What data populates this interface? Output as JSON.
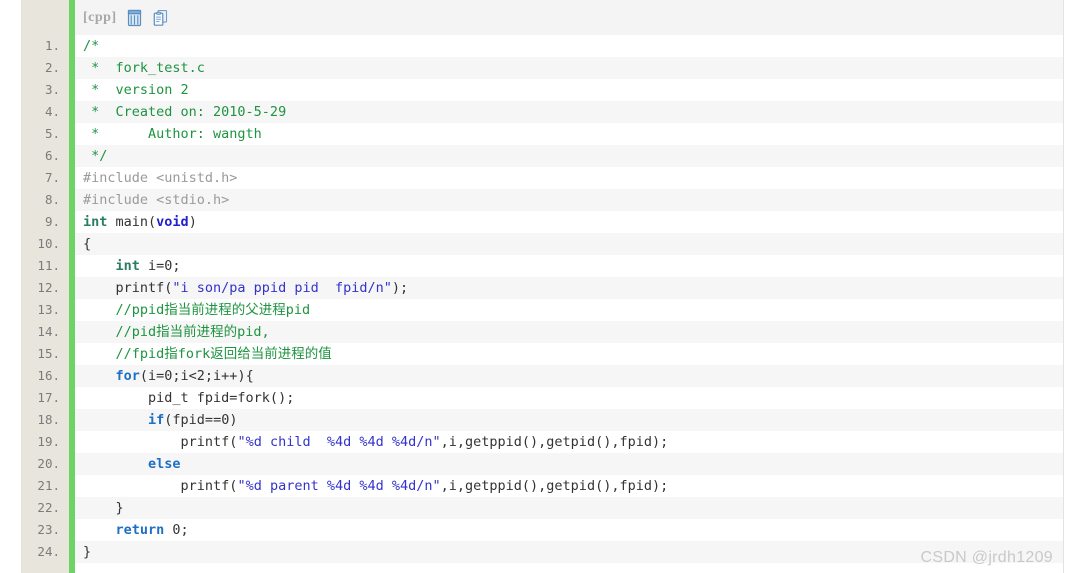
{
  "toolbar": {
    "language_label": "[cpp]",
    "icons": [
      {
        "name": "view-plain-icon",
        "title": "view plain"
      },
      {
        "name": "copy-to-clipboard-icon",
        "title": "copy"
      }
    ]
  },
  "watermark": {
    "text": "CSDN @jrdh1209"
  },
  "colors": {
    "gutter_bg": "#e8e6dc",
    "green_bar": "#6ed264",
    "row_odd": "#ffffff",
    "row_even": "#f6f6f6",
    "toolbar_bg": "#f4f4f4",
    "comment": "#1e9440",
    "keyword": "#1f6fc4",
    "type": "#2a7f62",
    "string": "#3333cc",
    "preprocessor": "#9a9a9a",
    "plain": "#333333",
    "line_number": "#7b7b7b",
    "watermark": "#c9c9c9"
  },
  "code": {
    "language": "cpp",
    "lines": [
      {
        "n": "1.",
        "tokens": [
          {
            "t": "/*",
            "c": "cm"
          }
        ]
      },
      {
        "n": "2.",
        "tokens": [
          {
            "t": " *  fork_test.c",
            "c": "cm"
          }
        ]
      },
      {
        "n": "3.",
        "tokens": [
          {
            "t": " *  version 2",
            "c": "cm"
          }
        ]
      },
      {
        "n": "4.",
        "tokens": [
          {
            "t": " *  Created on: 2010-5-29",
            "c": "cm"
          }
        ]
      },
      {
        "n": "5.",
        "tokens": [
          {
            "t": " *      Author: wangth",
            "c": "cm"
          }
        ]
      },
      {
        "n": "6.",
        "tokens": [
          {
            "t": " */",
            "c": "cm"
          }
        ]
      },
      {
        "n": "7.",
        "tokens": [
          {
            "t": "#include <unistd.h>",
            "c": "pp"
          }
        ]
      },
      {
        "n": "8.",
        "tokens": [
          {
            "t": "#include <stdio.h>",
            "c": "pp"
          }
        ]
      },
      {
        "n": "9.",
        "tokens": [
          {
            "t": "int",
            "c": "ty"
          },
          {
            "t": " main(",
            "c": "pl"
          },
          {
            "t": "void",
            "c": "kb"
          },
          {
            "t": ")",
            "c": "pl"
          }
        ]
      },
      {
        "n": "10.",
        "tokens": [
          {
            "t": "{",
            "c": "pl"
          }
        ]
      },
      {
        "n": "11.",
        "tokens": [
          {
            "t": "    ",
            "c": "pl"
          },
          {
            "t": "int",
            "c": "ty"
          },
          {
            "t": " i=0;",
            "c": "pl"
          }
        ]
      },
      {
        "n": "12.",
        "tokens": [
          {
            "t": "    printf(",
            "c": "pl"
          },
          {
            "t": "\"i son/pa ppid pid  fpid/n\"",
            "c": "st"
          },
          {
            "t": ");",
            "c": "pl"
          }
        ]
      },
      {
        "n": "13.",
        "tokens": [
          {
            "t": "    //ppid指当前进程的父进程pid",
            "c": "cm"
          }
        ]
      },
      {
        "n": "14.",
        "tokens": [
          {
            "t": "    //pid指当前进程的pid,",
            "c": "cm"
          }
        ]
      },
      {
        "n": "15.",
        "tokens": [
          {
            "t": "    //fpid指fork返回给当前进程的值",
            "c": "cm"
          }
        ]
      },
      {
        "n": "16.",
        "tokens": [
          {
            "t": "    ",
            "c": "pl"
          },
          {
            "t": "for",
            "c": "kw"
          },
          {
            "t": "(i=0;i<2;i++){",
            "c": "pl"
          }
        ]
      },
      {
        "n": "17.",
        "tokens": [
          {
            "t": "        pid_t fpid=fork();",
            "c": "pl"
          }
        ]
      },
      {
        "n": "18.",
        "tokens": [
          {
            "t": "        ",
            "c": "pl"
          },
          {
            "t": "if",
            "c": "kw"
          },
          {
            "t": "(fpid==0)",
            "c": "pl"
          }
        ]
      },
      {
        "n": "19.",
        "tokens": [
          {
            "t": "            printf(",
            "c": "pl"
          },
          {
            "t": "\"%d child  %4d %4d %4d/n\"",
            "c": "st"
          },
          {
            "t": ",i,getppid(),getpid(),fpid);",
            "c": "pl"
          }
        ]
      },
      {
        "n": "20.",
        "tokens": [
          {
            "t": "        ",
            "c": "pl"
          },
          {
            "t": "else",
            "c": "kw"
          }
        ]
      },
      {
        "n": "21.",
        "tokens": [
          {
            "t": "            printf(",
            "c": "pl"
          },
          {
            "t": "\"%d parent %4d %4d %4d/n\"",
            "c": "st"
          },
          {
            "t": ",i,getppid(),getpid(),fpid);",
            "c": "pl"
          }
        ]
      },
      {
        "n": "22.",
        "tokens": [
          {
            "t": "    }",
            "c": "pl"
          }
        ]
      },
      {
        "n": "23.",
        "tokens": [
          {
            "t": "    ",
            "c": "pl"
          },
          {
            "t": "return",
            "c": "kw"
          },
          {
            "t": " 0;",
            "c": "pl"
          }
        ]
      },
      {
        "n": "24.",
        "tokens": [
          {
            "t": "}",
            "c": "pl"
          }
        ]
      }
    ]
  }
}
